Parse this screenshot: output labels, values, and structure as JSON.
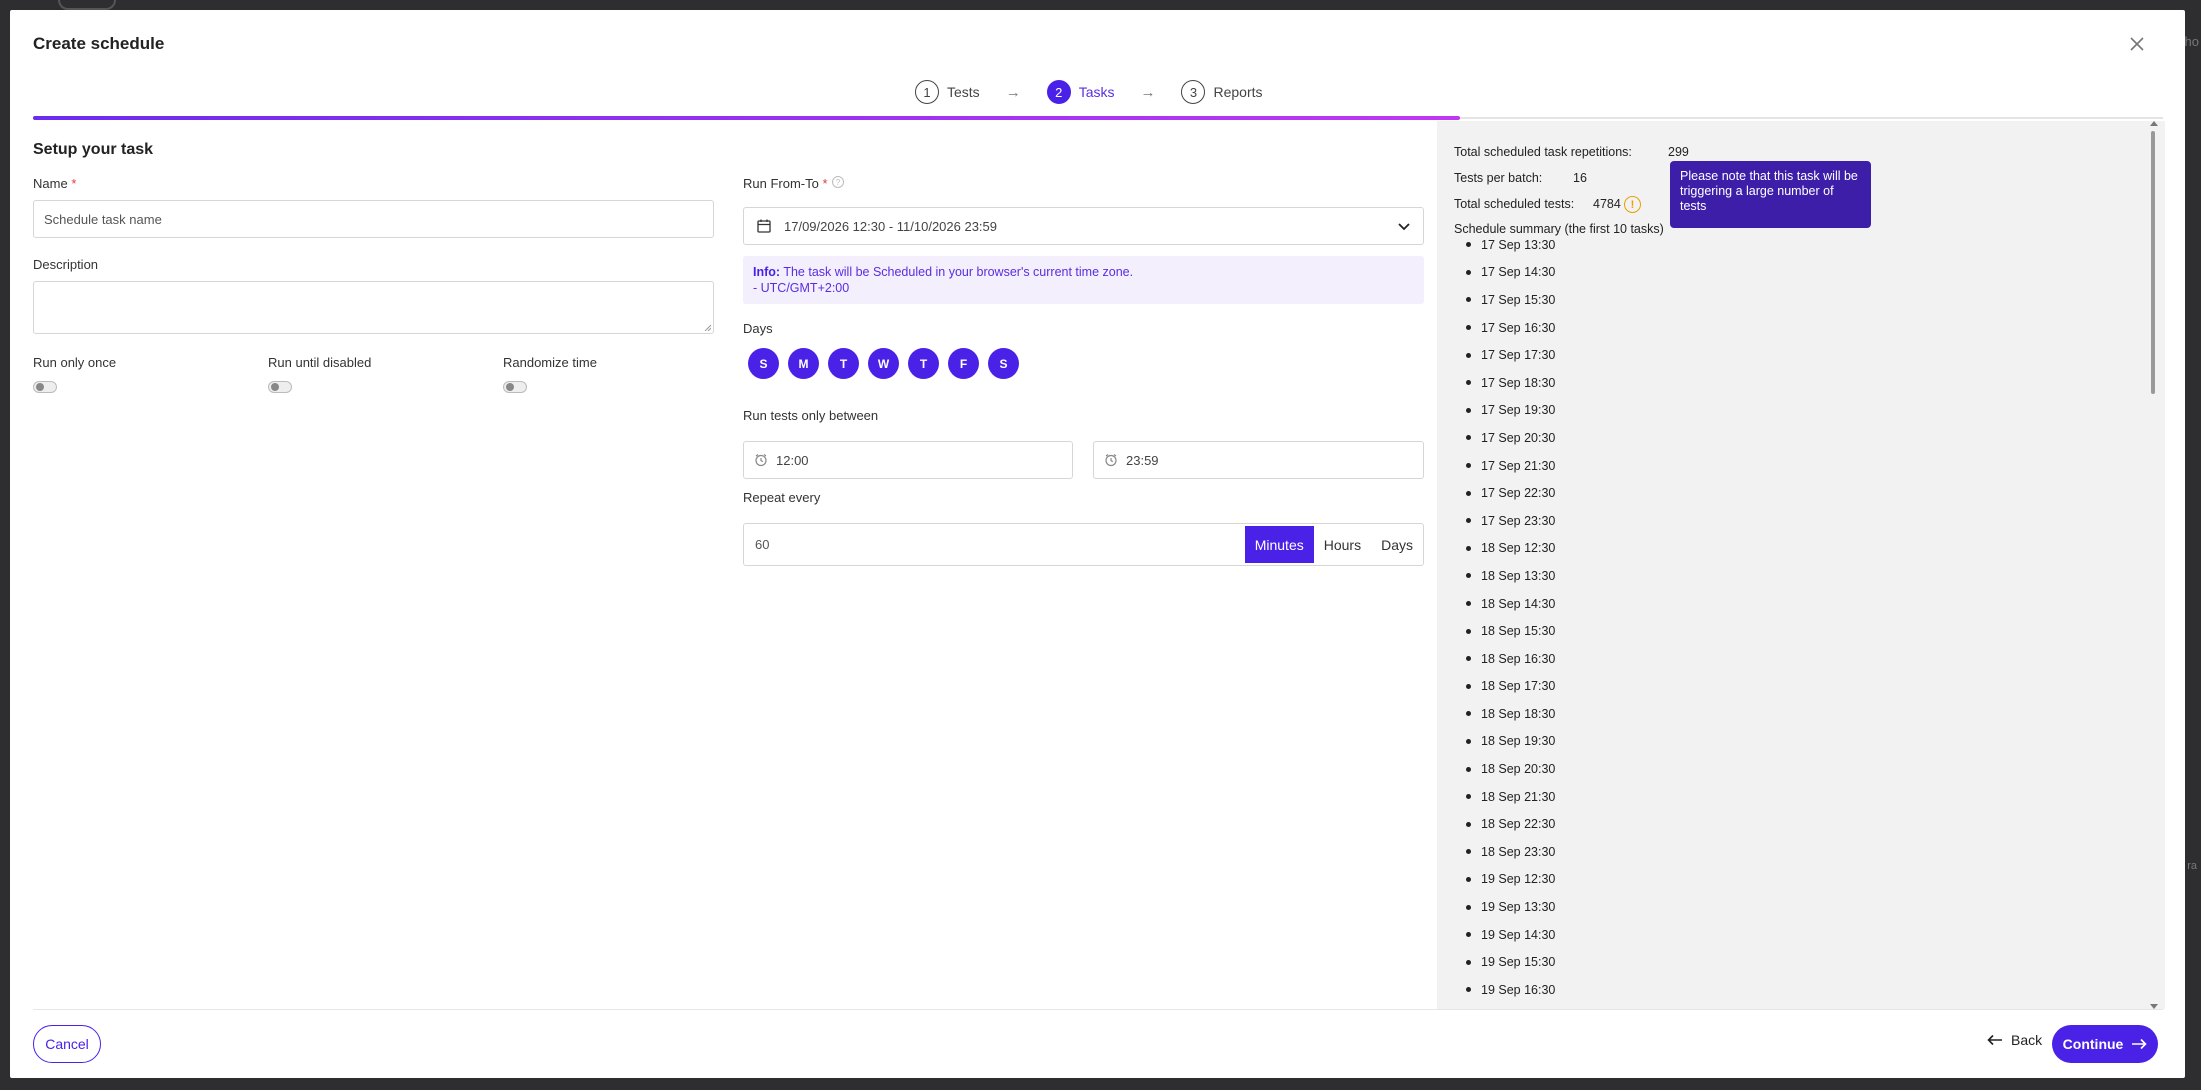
{
  "background": {
    "right_text": "Sho",
    "right_text_lower": "ra"
  },
  "modal": {
    "title": "Create schedule"
  },
  "stepper": {
    "steps": [
      {
        "num": "1",
        "label": "Tests"
      },
      {
        "num": "2",
        "label": "Tasks"
      },
      {
        "num": "3",
        "label": "Reports"
      }
    ],
    "active_index": 1,
    "progress": 0.485
  },
  "form": {
    "section_title": "Setup your task",
    "name_label": "Name",
    "name_placeholder": "Schedule task name",
    "description_label": "Description",
    "toggles": [
      {
        "label": "Run only once",
        "on": false
      },
      {
        "label": "Run until disabled",
        "on": false
      },
      {
        "label": "Randomize time",
        "on": false
      }
    ],
    "run_from_to_label": "Run From-To",
    "run_from_to_value": "17/09/2026 12:30 - 11/10/2026 23:59",
    "info_prefix": "Info:",
    "info_text": "The task will be Scheduled in your browser's current time zone.",
    "info_timezone": "- UTC/GMT+2:00",
    "days_label": "Days",
    "days": [
      "S",
      "M",
      "T",
      "W",
      "T",
      "F",
      "S"
    ],
    "run_between_label": "Run tests only between",
    "time_from": "12:00",
    "time_to": "23:59",
    "repeat_label": "Repeat every",
    "repeat_value": "60",
    "repeat_units": [
      "Minutes",
      "Hours",
      "Days"
    ],
    "repeat_unit_selected": "Minutes"
  },
  "summary": {
    "repetitions_label": "Total scheduled task repetitions:",
    "repetitions_value": "299",
    "per_batch_label": "Tests per batch:",
    "per_batch_value": "16",
    "total_tests_label": "Total scheduled tests:",
    "total_tests_value": "4784",
    "tooltip": "Please note that this task will be triggering a large number of tests",
    "schedule_title": "Schedule summary (the first 10 tasks)",
    "items": [
      "17 Sep 13:30",
      "17 Sep 14:30",
      "17 Sep 15:30",
      "17 Sep 16:30",
      "17 Sep 17:30",
      "17 Sep 18:30",
      "17 Sep 19:30",
      "17 Sep 20:30",
      "17 Sep 21:30",
      "17 Sep 22:30",
      "17 Sep 23:30",
      "18 Sep 12:30",
      "18 Sep 13:30",
      "18 Sep 14:30",
      "18 Sep 15:30",
      "18 Sep 16:30",
      "18 Sep 17:30",
      "18 Sep 18:30",
      "18 Sep 19:30",
      "18 Sep 20:30",
      "18 Sep 21:30",
      "18 Sep 22:30",
      "18 Sep 23:30",
      "19 Sep 12:30",
      "19 Sep 13:30",
      "19 Sep 14:30",
      "19 Sep 15:30",
      "19 Sep 16:30"
    ]
  },
  "footer": {
    "cancel_label": "Cancel",
    "back_label": "Back",
    "continue_label": "Continue"
  },
  "colors": {
    "accent": "#4a21e6",
    "tooltip_bg": "#3d1ea8",
    "warning": "#e8a000",
    "info_bg": "#f3effc",
    "panel_bg": "#f2f2f2"
  }
}
